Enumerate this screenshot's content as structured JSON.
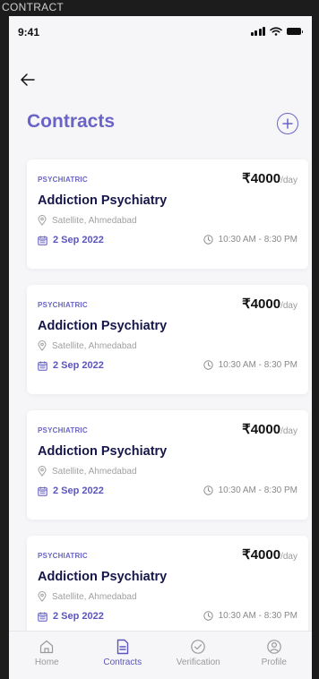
{
  "frame_label": "CONTRACT",
  "status_bar": {
    "time": "9:41"
  },
  "header": {
    "title": "Contracts"
  },
  "contracts": [
    {
      "category": "PSYCHIATRIC",
      "price": "₹4000",
      "unit": "/day",
      "title": "Addiction Psychiatry",
      "location": "Satellite, Ahmedabad",
      "date": "2 Sep 2022",
      "time": "10:30 AM - 8:30 PM"
    },
    {
      "category": "PSYCHIATRIC",
      "price": "₹4000",
      "unit": "/day",
      "title": "Addiction Psychiatry",
      "location": "Satellite, Ahmedabad",
      "date": "2 Sep 2022",
      "time": "10:30 AM - 8:30 PM"
    },
    {
      "category": "PSYCHIATRIC",
      "price": "₹4000",
      "unit": "/day",
      "title": "Addiction Psychiatry",
      "location": "Satellite, Ahmedabad",
      "date": "2 Sep 2022",
      "time": "10:30 AM - 8:30 PM"
    },
    {
      "category": "PSYCHIATRIC",
      "price": "₹4000",
      "unit": "/day",
      "title": "Addiction Psychiatry",
      "location": "Satellite, Ahmedabad",
      "date": "2 Sep 2022",
      "time": "10:30 AM - 8:30 PM"
    }
  ],
  "bottom_nav": [
    {
      "label": "Home",
      "icon": "home-icon",
      "active": false
    },
    {
      "label": "Contracts",
      "icon": "document-icon",
      "active": true
    },
    {
      "label": "Verification",
      "icon": "check-circle-icon",
      "active": false
    },
    {
      "label": "Profile",
      "icon": "profile-icon",
      "active": false
    }
  ],
  "colors": {
    "accent": "#6a64c8",
    "title": "#16164a",
    "background": "#f6f6f8",
    "muted": "#a0a0a0"
  }
}
